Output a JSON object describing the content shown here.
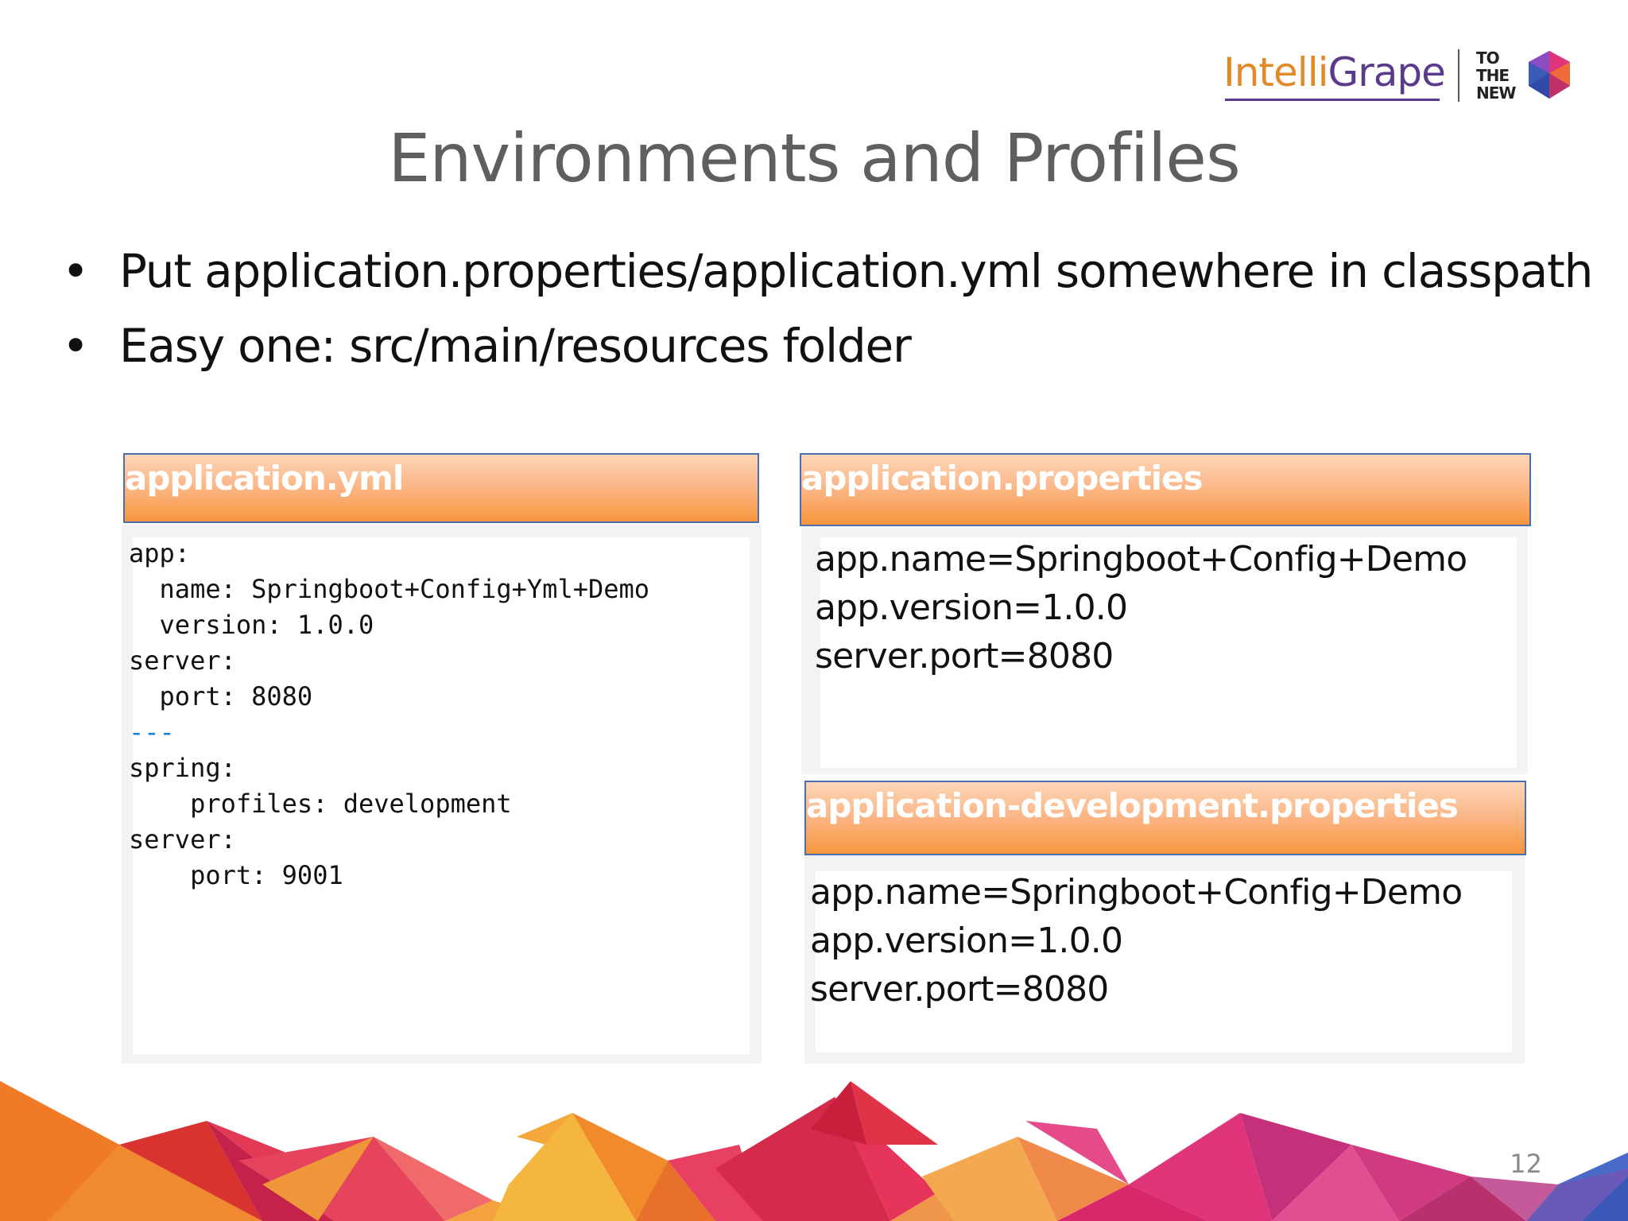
{
  "logo": {
    "brand_prefix": "Intelli",
    "brand_suffix": "Grape",
    "secondary_brand": "TO THE NEW"
  },
  "slide": {
    "title": "Environments and Profiles",
    "bullets": [
      "Put application.properties/application.yml somewhere in classpath",
      "Easy one: src/main/resources folder"
    ],
    "page_number": "12"
  },
  "yml_panel": {
    "header": "application.yml",
    "lines": [
      "app:",
      "  name: Springboot+Config+Yml+Demo",
      "  version: 1.0.0",
      "server:",
      "  port: 8080",
      "---",
      "spring:",
      "    profiles: development",
      "server:",
      "    port: 9001"
    ]
  },
  "properties_panel": {
    "header": "application.properties",
    "lines": [
      "app.name=Springboot+Config+Demo",
      "app.version=1.0.0",
      "server.port=8080"
    ]
  },
  "dev_properties_panel": {
    "header": "application-development.properties",
    "lines": [
      "app.name=Springboot+Config+Demo",
      "app.version=1.0.0",
      "server.port=8080"
    ]
  },
  "colors": {
    "header_orange": "#f7963d",
    "header_border": "#4a6eb0",
    "title_gray": "#5f5f5f",
    "yaml_separator_blue": "#1a7fd4"
  }
}
